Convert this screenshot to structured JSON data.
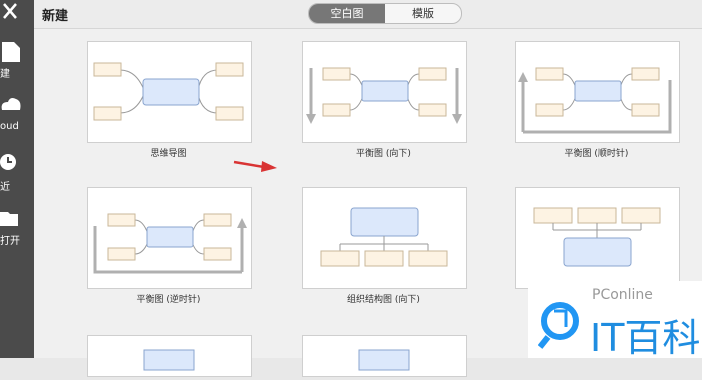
{
  "header": {
    "title": "新建",
    "tabs": [
      "空白图",
      "模版"
    ]
  },
  "sidebar": [
    {
      "label": "建",
      "icon": "new-file-icon"
    },
    {
      "label": "oud",
      "icon": "cloud-icon"
    },
    {
      "label": "近",
      "icon": "clock-icon"
    },
    {
      "label": "打开",
      "icon": "folder-icon"
    }
  ],
  "templates": [
    {
      "caption": "思维导图",
      "icon": "mindmap-icon"
    },
    {
      "caption": "平衡图 (向下)",
      "icon": "balance-down-icon"
    },
    {
      "caption": "平衡图 (顺时针)",
      "icon": "balance-clockwise-icon"
    },
    {
      "caption": "平衡图 (逆时针)",
      "icon": "balance-counterclockwise-icon"
    },
    {
      "caption": "组织结构图 (向下)",
      "icon": "org-chart-down-icon"
    },
    {
      "caption": "",
      "icon": "org-chart-up-icon"
    }
  ],
  "watermark": {
    "text1": "PConline",
    "text2": "IT百科"
  },
  "colors": {
    "sidebar": "#4b4b4b",
    "node_main": "#dce8fb",
    "node_sub": "#fdf3e3",
    "accent": "#d93434"
  }
}
